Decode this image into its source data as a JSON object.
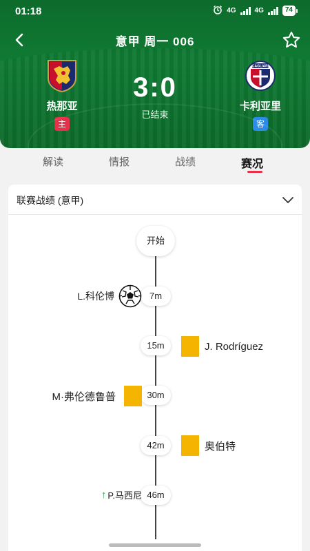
{
  "status": {
    "time": "01:18",
    "net1": "4G",
    "net2": "4G",
    "battery": "74"
  },
  "nav": {
    "title": "意甲 周一 006"
  },
  "match": {
    "home": {
      "name": "热那亚",
      "badge": "主"
    },
    "away": {
      "name": "卡利亚里",
      "badge": "客",
      "crest_text": "CAGLIARI"
    },
    "score": "3:0",
    "status": "已结束"
  },
  "tabs": [
    {
      "label": "解读"
    },
    {
      "label": "情报"
    },
    {
      "label": "战绩"
    },
    {
      "label": "赛况"
    }
  ],
  "active_tab": "赛况",
  "section": {
    "title": "联赛战绩 (意甲)"
  },
  "timeline": {
    "start_label": "开始",
    "events": [
      {
        "minute": "7m",
        "side": "home",
        "type": "goal",
        "icon": "soccer-ball-icon",
        "player": "L.科伦博"
      },
      {
        "minute": "15m",
        "side": "away",
        "type": "yellow-card",
        "icon": "yellow-card-icon",
        "player": "J. Rodríguez"
      },
      {
        "minute": "30m",
        "side": "home",
        "type": "yellow-card",
        "icon": "yellow-card-icon",
        "player": "M·弗伦德鲁普"
      },
      {
        "minute": "42m",
        "side": "away",
        "type": "yellow-card",
        "icon": "yellow-card-icon",
        "player": "奥伯特"
      },
      {
        "minute": "46m",
        "side": "home",
        "type": "substitution",
        "icon": "sub-in-arrow-icon",
        "arrow": "↑",
        "player": "P.马西尼"
      }
    ]
  },
  "colors": {
    "header_green": "#0d6b2c",
    "accent_red": "#e8304a",
    "away_blue": "#2d8be8",
    "yellow_card": "#f4b400"
  }
}
